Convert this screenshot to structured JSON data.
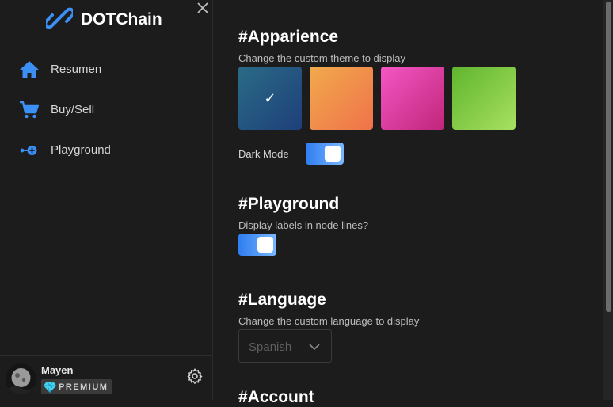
{
  "brand": {
    "name": "DOTChain",
    "accent": "#3b8ff5"
  },
  "sidebar": {
    "items": [
      {
        "label": "Resumen",
        "icon": "home-icon"
      },
      {
        "label": "Buy/Sell",
        "icon": "cart-icon"
      },
      {
        "label": "Playground",
        "icon": "node-add-icon"
      }
    ]
  },
  "user": {
    "name": "Mayen",
    "badge": "PREMIUM",
    "badge_icon": "diamond-icon"
  },
  "settings": {
    "appearance": {
      "title": "#Apparience",
      "description": "Change the custom theme to display",
      "themes": [
        {
          "name": "blue",
          "from": "#2a6b86",
          "to": "#1e3f7a",
          "selected": true
        },
        {
          "name": "orange",
          "from": "#f1aa4c",
          "to": "#f0724a",
          "selected": false
        },
        {
          "name": "pink",
          "from": "#f457c4",
          "to": "#c0267a",
          "selected": false
        },
        {
          "name": "green",
          "from": "#5fb52e",
          "to": "#a8e060",
          "selected": false
        }
      ],
      "check_mark": "✓",
      "dark_mode_label": "Dark Mode",
      "dark_mode": true
    },
    "playground": {
      "title": "#Playground",
      "description": "Display labels in node lines?",
      "labels_enabled": true
    },
    "language": {
      "title": "#Language",
      "description": "Change the custom language to display",
      "selected": "Spanish"
    },
    "account": {
      "title": "#Account"
    }
  }
}
